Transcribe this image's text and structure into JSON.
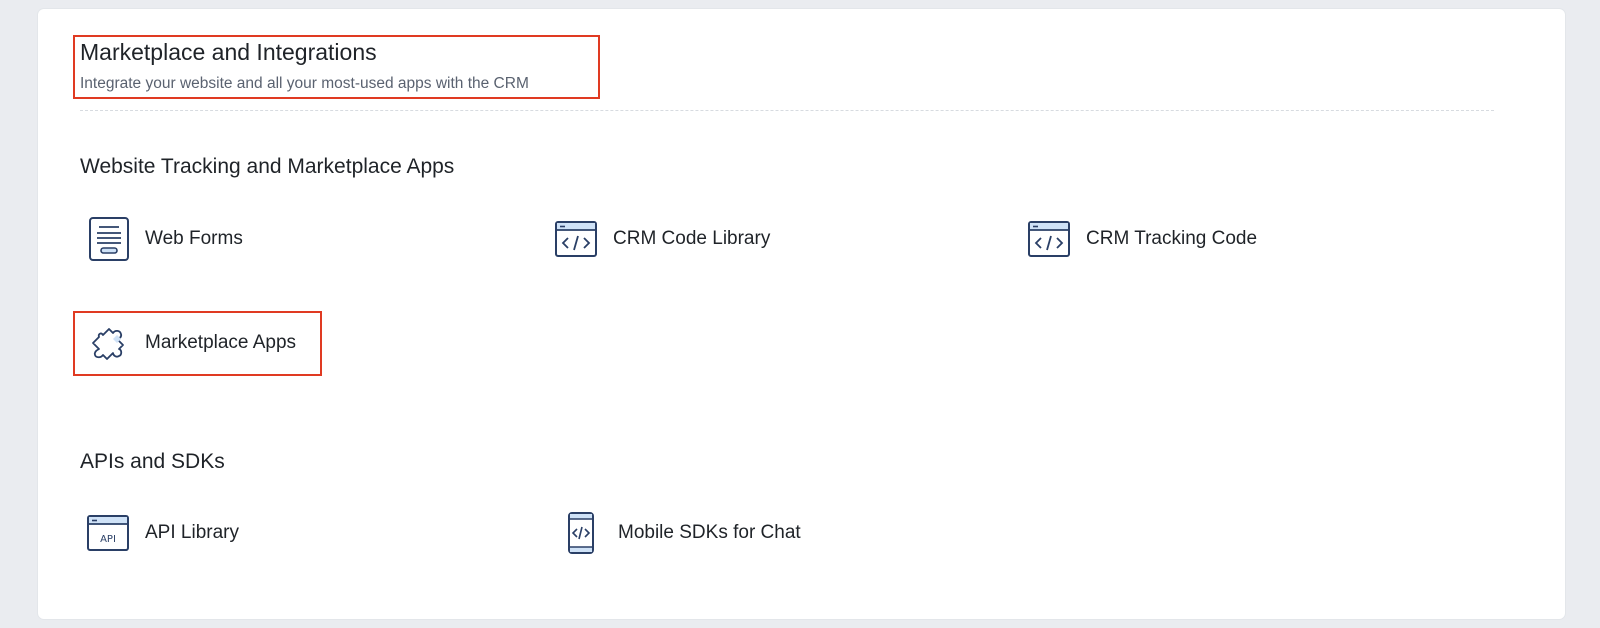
{
  "header": {
    "title": "Marketplace and Integrations",
    "subtitle": "Integrate your website and all your most-used apps with the CRM"
  },
  "sections": [
    {
      "title": "Website Tracking and Marketplace Apps",
      "items": [
        {
          "label": "Web Forms",
          "icon": "form-icon"
        },
        {
          "label": "CRM Code Library",
          "icon": "code-window-icon"
        },
        {
          "label": "CRM Tracking Code",
          "icon": "code-window-icon"
        },
        {
          "label": "Marketplace Apps",
          "icon": "puzzle-icon"
        }
      ]
    },
    {
      "title": "APIs and SDKs",
      "items": [
        {
          "label": "API Library",
          "icon": "api-window-icon"
        },
        {
          "label": "Mobile SDKs for Chat",
          "icon": "mobile-code-icon"
        }
      ]
    }
  ],
  "colors": {
    "highlight": "#e03a22",
    "icon_stroke": "#2a3f66",
    "icon_fill": "#cfe2f7"
  }
}
